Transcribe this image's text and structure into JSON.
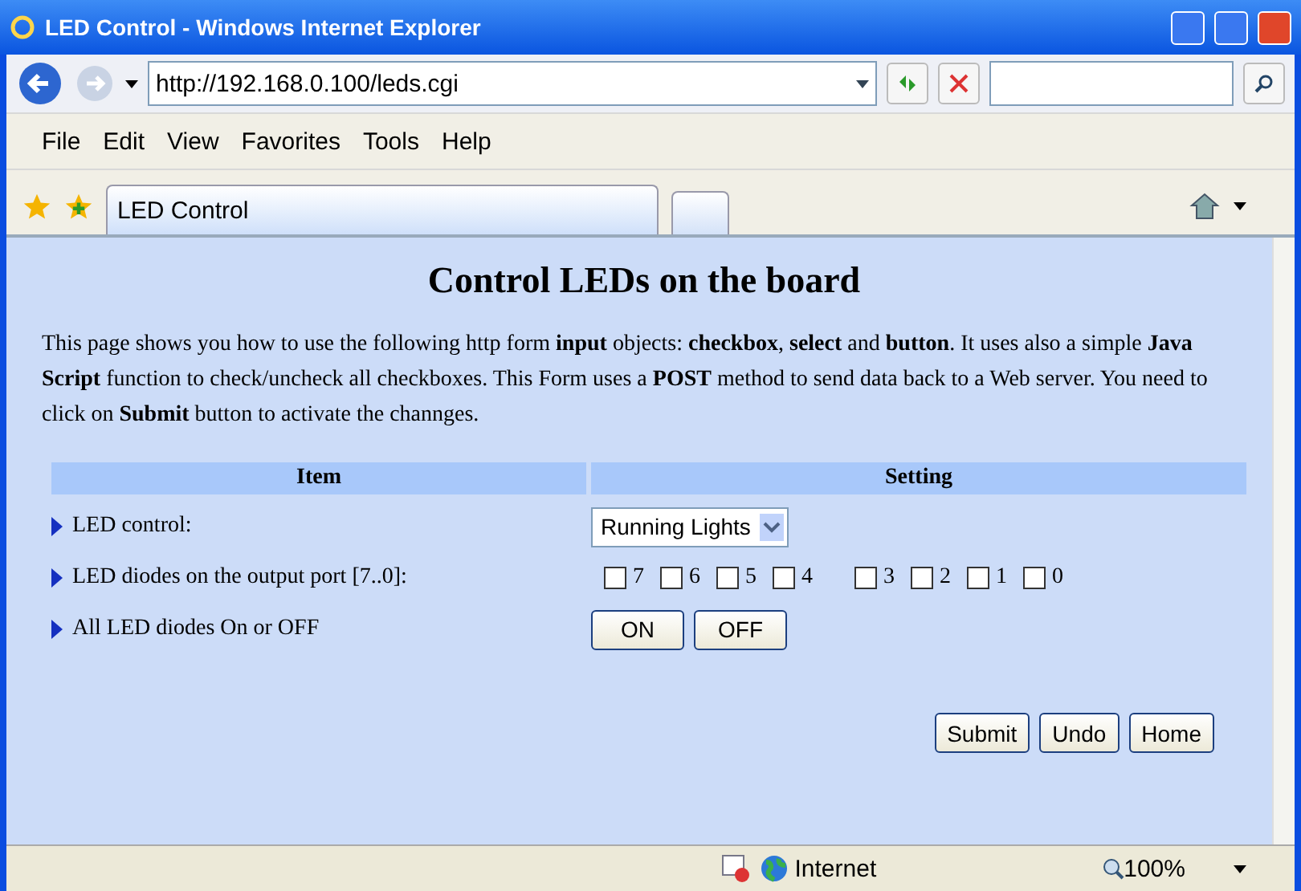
{
  "window": {
    "title": "LED Control - Windows Internet Explorer"
  },
  "address": {
    "url": "http://192.168.0.100/leds.cgi"
  },
  "menu": [
    "File",
    "Edit",
    "View",
    "Favorites",
    "Tools",
    "Help"
  ],
  "tabs": [
    {
      "label": "LED Control",
      "selected": true
    }
  ],
  "page": {
    "heading": "Control LEDs on the board",
    "intro": "This page shows you how to use the following http form **input** objects: **checkbox**, **select** and **button**. It uses also a simple **Java Script** function to check/uncheck all checkboxes. This Form uses a **POST** method to send data back to a Web server. You need to click on **Submit** button to activate the channges.",
    "columns": [
      "Item",
      "Setting"
    ],
    "rows": [
      {
        "kind": "select",
        "label": "LED control:",
        "value": "Running Lights"
      },
      {
        "kind": "checkboxes",
        "label": "LED diodes on the output port [7..0]:",
        "boxes": [
          {
            "label": "7",
            "checked": false
          },
          {
            "label": "6",
            "checked": false
          },
          {
            "label": "5",
            "checked": false
          },
          {
            "label": "4",
            "checked": false
          },
          {
            "label": "3",
            "checked": false
          },
          {
            "label": "2",
            "checked": false
          },
          {
            "label": "1",
            "checked": false
          },
          {
            "label": "0",
            "checked": false
          }
        ]
      },
      {
        "kind": "buttons",
        "label": "All LED diodes On or OFF",
        "buttons": [
          "ON",
          "OFF"
        ]
      }
    ],
    "actions": [
      "Submit",
      "Undo",
      "Home"
    ]
  },
  "status_bar": {
    "zone": "Internet",
    "zoom": "100%"
  }
}
